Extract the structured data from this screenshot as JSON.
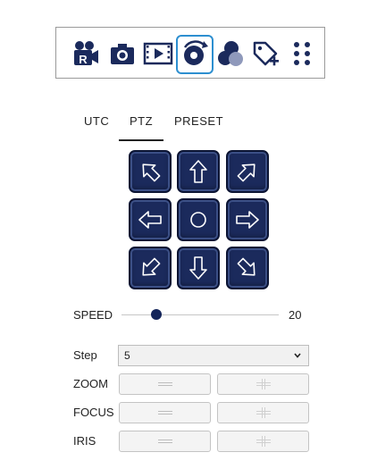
{
  "toolbar": {
    "icons": [
      {
        "name": "record-camera-icon"
      },
      {
        "name": "snapshot-camera-icon"
      },
      {
        "name": "video-playback-icon"
      },
      {
        "name": "ptz-control-icon",
        "active": true
      },
      {
        "name": "color-adjust-icon"
      },
      {
        "name": "tag-add-icon"
      },
      {
        "name": "more-grid-icon"
      }
    ],
    "active_color": "#2d8fd0",
    "icon_color": "#1b2a5c"
  },
  "tabs": {
    "utc": "UTC",
    "ptz": "PTZ",
    "preset": "PRESET",
    "active": "PTZ"
  },
  "pad": {
    "button_color": "#1b2a5c",
    "buttons": [
      "up-left",
      "up",
      "up-right",
      "left",
      "home",
      "right",
      "down-left",
      "down",
      "down-right"
    ]
  },
  "speed": {
    "label": "SPEED",
    "value": "20",
    "fraction": 0.22
  },
  "step": {
    "label": "Step",
    "value": "5"
  },
  "zoom": {
    "label": "ZOOM"
  },
  "focus": {
    "label": "FOCUS"
  },
  "iris": {
    "label": "IRIS"
  }
}
